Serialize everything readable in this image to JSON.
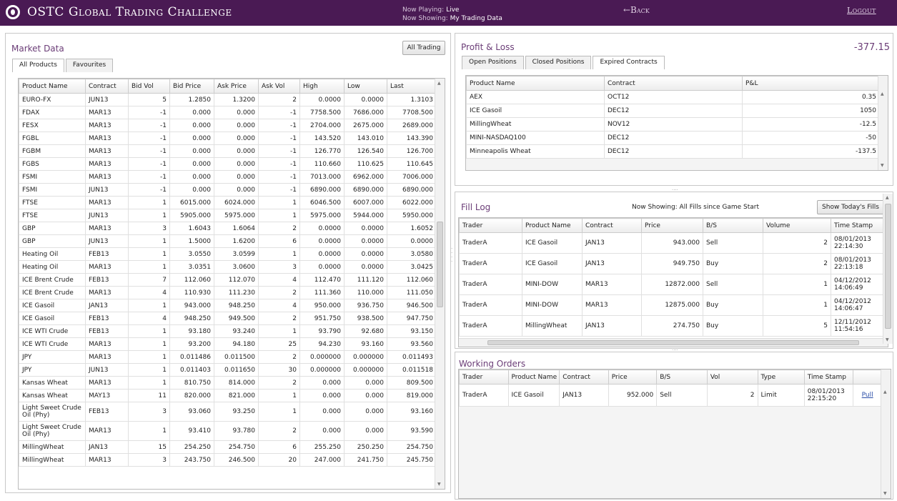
{
  "header": {
    "title": "OSTC Global Trading Challenge",
    "now_playing_label": "Now Playing:",
    "now_playing_value": "Live",
    "now_showing_label": "Now Showing:",
    "now_showing_value": "My Trading Data",
    "back_label": "←Back",
    "logout_label": "Logout"
  },
  "market": {
    "title": "Market Data",
    "all_trading_button": "All Trading",
    "tabs": [
      "All Products",
      "Favourites"
    ],
    "columns": [
      "Product Name",
      "Contract",
      "Bid Vol",
      "Bid Price",
      "Ask Price",
      "Ask Vol",
      "High",
      "Low",
      "Last"
    ],
    "rows": [
      [
        "EURO-FX",
        "JUN13",
        "5",
        "1.2850",
        "1.3200",
        "2",
        "0.0000",
        "0.0000",
        "1.3103"
      ],
      [
        "FDAX",
        "MAR13",
        "-1",
        "0.000",
        "0.000",
        "-1",
        "7758.500",
        "7686.000",
        "7708.500"
      ],
      [
        "FESX",
        "MAR13",
        "-1",
        "0.000",
        "0.000",
        "-1",
        "2704.000",
        "2675.000",
        "2689.000"
      ],
      [
        "FGBL",
        "MAR13",
        "-1",
        "0.000",
        "0.000",
        "-1",
        "143.520",
        "143.010",
        "143.390"
      ],
      [
        "FGBM",
        "MAR13",
        "-1",
        "0.000",
        "0.000",
        "-1",
        "126.770",
        "126.540",
        "126.700"
      ],
      [
        "FGBS",
        "MAR13",
        "-1",
        "0.000",
        "0.000",
        "-1",
        "110.660",
        "110.625",
        "110.645"
      ],
      [
        "FSMI",
        "MAR13",
        "-1",
        "0.000",
        "0.000",
        "-1",
        "7013.000",
        "6962.000",
        "7006.000"
      ],
      [
        "FSMI",
        "JUN13",
        "-1",
        "0.000",
        "0.000",
        "-1",
        "6890.000",
        "6890.000",
        "6890.000"
      ],
      [
        "FTSE",
        "MAR13",
        "1",
        "6015.000",
        "6024.000",
        "1",
        "6046.500",
        "6007.000",
        "6022.000"
      ],
      [
        "FTSE",
        "JUN13",
        "1",
        "5905.000",
        "5975.000",
        "1",
        "5975.000",
        "5944.000",
        "5950.000"
      ],
      [
        "GBP",
        "MAR13",
        "3",
        "1.6043",
        "1.6064",
        "2",
        "0.0000",
        "0.0000",
        "1.6052"
      ],
      [
        "GBP",
        "JUN13",
        "1",
        "1.5000",
        "1.6200",
        "6",
        "0.0000",
        "0.0000",
        "0.0000"
      ],
      [
        "Heating Oil",
        "FEB13",
        "1",
        "3.0550",
        "3.0599",
        "1",
        "0.0000",
        "0.0000",
        "3.0580"
      ],
      [
        "Heating Oil",
        "MAR13",
        "1",
        "3.0351",
        "3.0600",
        "3",
        "0.0000",
        "0.0000",
        "3.0425"
      ],
      [
        "ICE Brent Crude",
        "FEB13",
        "7",
        "112.060",
        "112.070",
        "4",
        "112.470",
        "111.120",
        "112.060"
      ],
      [
        "ICE Brent Crude",
        "MAR13",
        "4",
        "110.930",
        "111.230",
        "2",
        "111.360",
        "110.000",
        "111.050"
      ],
      [
        "ICE Gasoil",
        "JAN13",
        "1",
        "943.000",
        "948.250",
        "4",
        "950.000",
        "936.750",
        "946.500"
      ],
      [
        "ICE Gasoil",
        "FEB13",
        "4",
        "948.250",
        "949.500",
        "2",
        "951.750",
        "938.500",
        "947.750"
      ],
      [
        "ICE WTI Crude",
        "FEB13",
        "1",
        "93.180",
        "93.240",
        "1",
        "93.790",
        "92.680",
        "93.150"
      ],
      [
        "ICE WTI Crude",
        "MAR13",
        "1",
        "93.200",
        "94.180",
        "25",
        "94.230",
        "93.160",
        "93.560"
      ],
      [
        "JPY",
        "MAR13",
        "1",
        "0.011486",
        "0.011500",
        "2",
        "0.000000",
        "0.000000",
        "0.011493"
      ],
      [
        "JPY",
        "JUN13",
        "1",
        "0.011403",
        "0.011650",
        "30",
        "0.000000",
        "0.000000",
        "0.011518"
      ],
      [
        "Kansas Wheat",
        "MAR13",
        "1",
        "810.750",
        "814.000",
        "2",
        "0.000",
        "0.000",
        "809.500"
      ],
      [
        "Kansas Wheat",
        "MAY13",
        "11",
        "820.000",
        "821.000",
        "1",
        "0.000",
        "0.000",
        "819.000"
      ],
      [
        "Light Sweet Crude Oil (Phy)",
        "FEB13",
        "3",
        "93.060",
        "93.250",
        "1",
        "0.000",
        "0.000",
        "93.160"
      ],
      [
        "Light Sweet Crude Oil (Phy)",
        "MAR13",
        "1",
        "93.410",
        "93.780",
        "2",
        "0.000",
        "0.000",
        "93.590"
      ],
      [
        "MillingWheat",
        "JAN13",
        "15",
        "254.250",
        "254.750",
        "6",
        "255.250",
        "250.250",
        "254.750"
      ],
      [
        "MillingWheat",
        "MAR13",
        "3",
        "243.750",
        "246.500",
        "20",
        "247.000",
        "241.750",
        "245.750"
      ]
    ]
  },
  "pnl": {
    "title": "Profit & Loss",
    "total": "-377.15",
    "tabs": [
      "Open Positions",
      "Closed Positions",
      "Expired Contracts"
    ],
    "columns": [
      "Product Name",
      "Contract",
      "P&L"
    ],
    "rows": [
      [
        "AEX",
        "OCT12",
        "0.35"
      ],
      [
        "ICE Gasoil",
        "DEC12",
        "1050"
      ],
      [
        "MillingWheat",
        "NOV12",
        "-12.5"
      ],
      [
        "MINI-NASDAQ100",
        "DEC12",
        "-50"
      ],
      [
        "Minneapolis Wheat",
        "DEC12",
        "-137.5"
      ]
    ]
  },
  "fill_log": {
    "title": "Fill Log",
    "now_showing": "Now Showing: All Fills since Game Start",
    "button": "Show Today's Fills",
    "columns": [
      "Trader",
      "Product Name",
      "Contract",
      "Price",
      "B/S",
      "Volume",
      "Time Stamp"
    ],
    "rows": [
      [
        "TraderA",
        "ICE Gasoil",
        "JAN13",
        "943.000",
        "Sell",
        "2",
        "08/01/2013 22:14:30"
      ],
      [
        "TraderA",
        "ICE Gasoil",
        "JAN13",
        "949.750",
        "Buy",
        "2",
        "08/01/2013 22:13:18"
      ],
      [
        "TraderA",
        "MINI-DOW",
        "MAR13",
        "12872.000",
        "Sell",
        "1",
        "04/12/2012 14:06:49"
      ],
      [
        "TraderA",
        "MINI-DOW",
        "MAR13",
        "12875.000",
        "Buy",
        "1",
        "04/12/2012 14:06:47"
      ],
      [
        "TraderA",
        "MillingWheat",
        "JAN13",
        "274.750",
        "Buy",
        "5",
        "12/11/2012 11:54:16"
      ]
    ]
  },
  "working_orders": {
    "title": "Working Orders",
    "columns": [
      "Trader",
      "Product Name",
      "Contract",
      "Price",
      "B/S",
      "Vol",
      "Type",
      "Time Stamp",
      ""
    ],
    "rows": [
      [
        "TraderA",
        "ICE Gasoil",
        "JAN13",
        "952.000",
        "Sell",
        "2",
        "Limit",
        "08/01/2013 22:15:20",
        "Pull"
      ]
    ]
  }
}
